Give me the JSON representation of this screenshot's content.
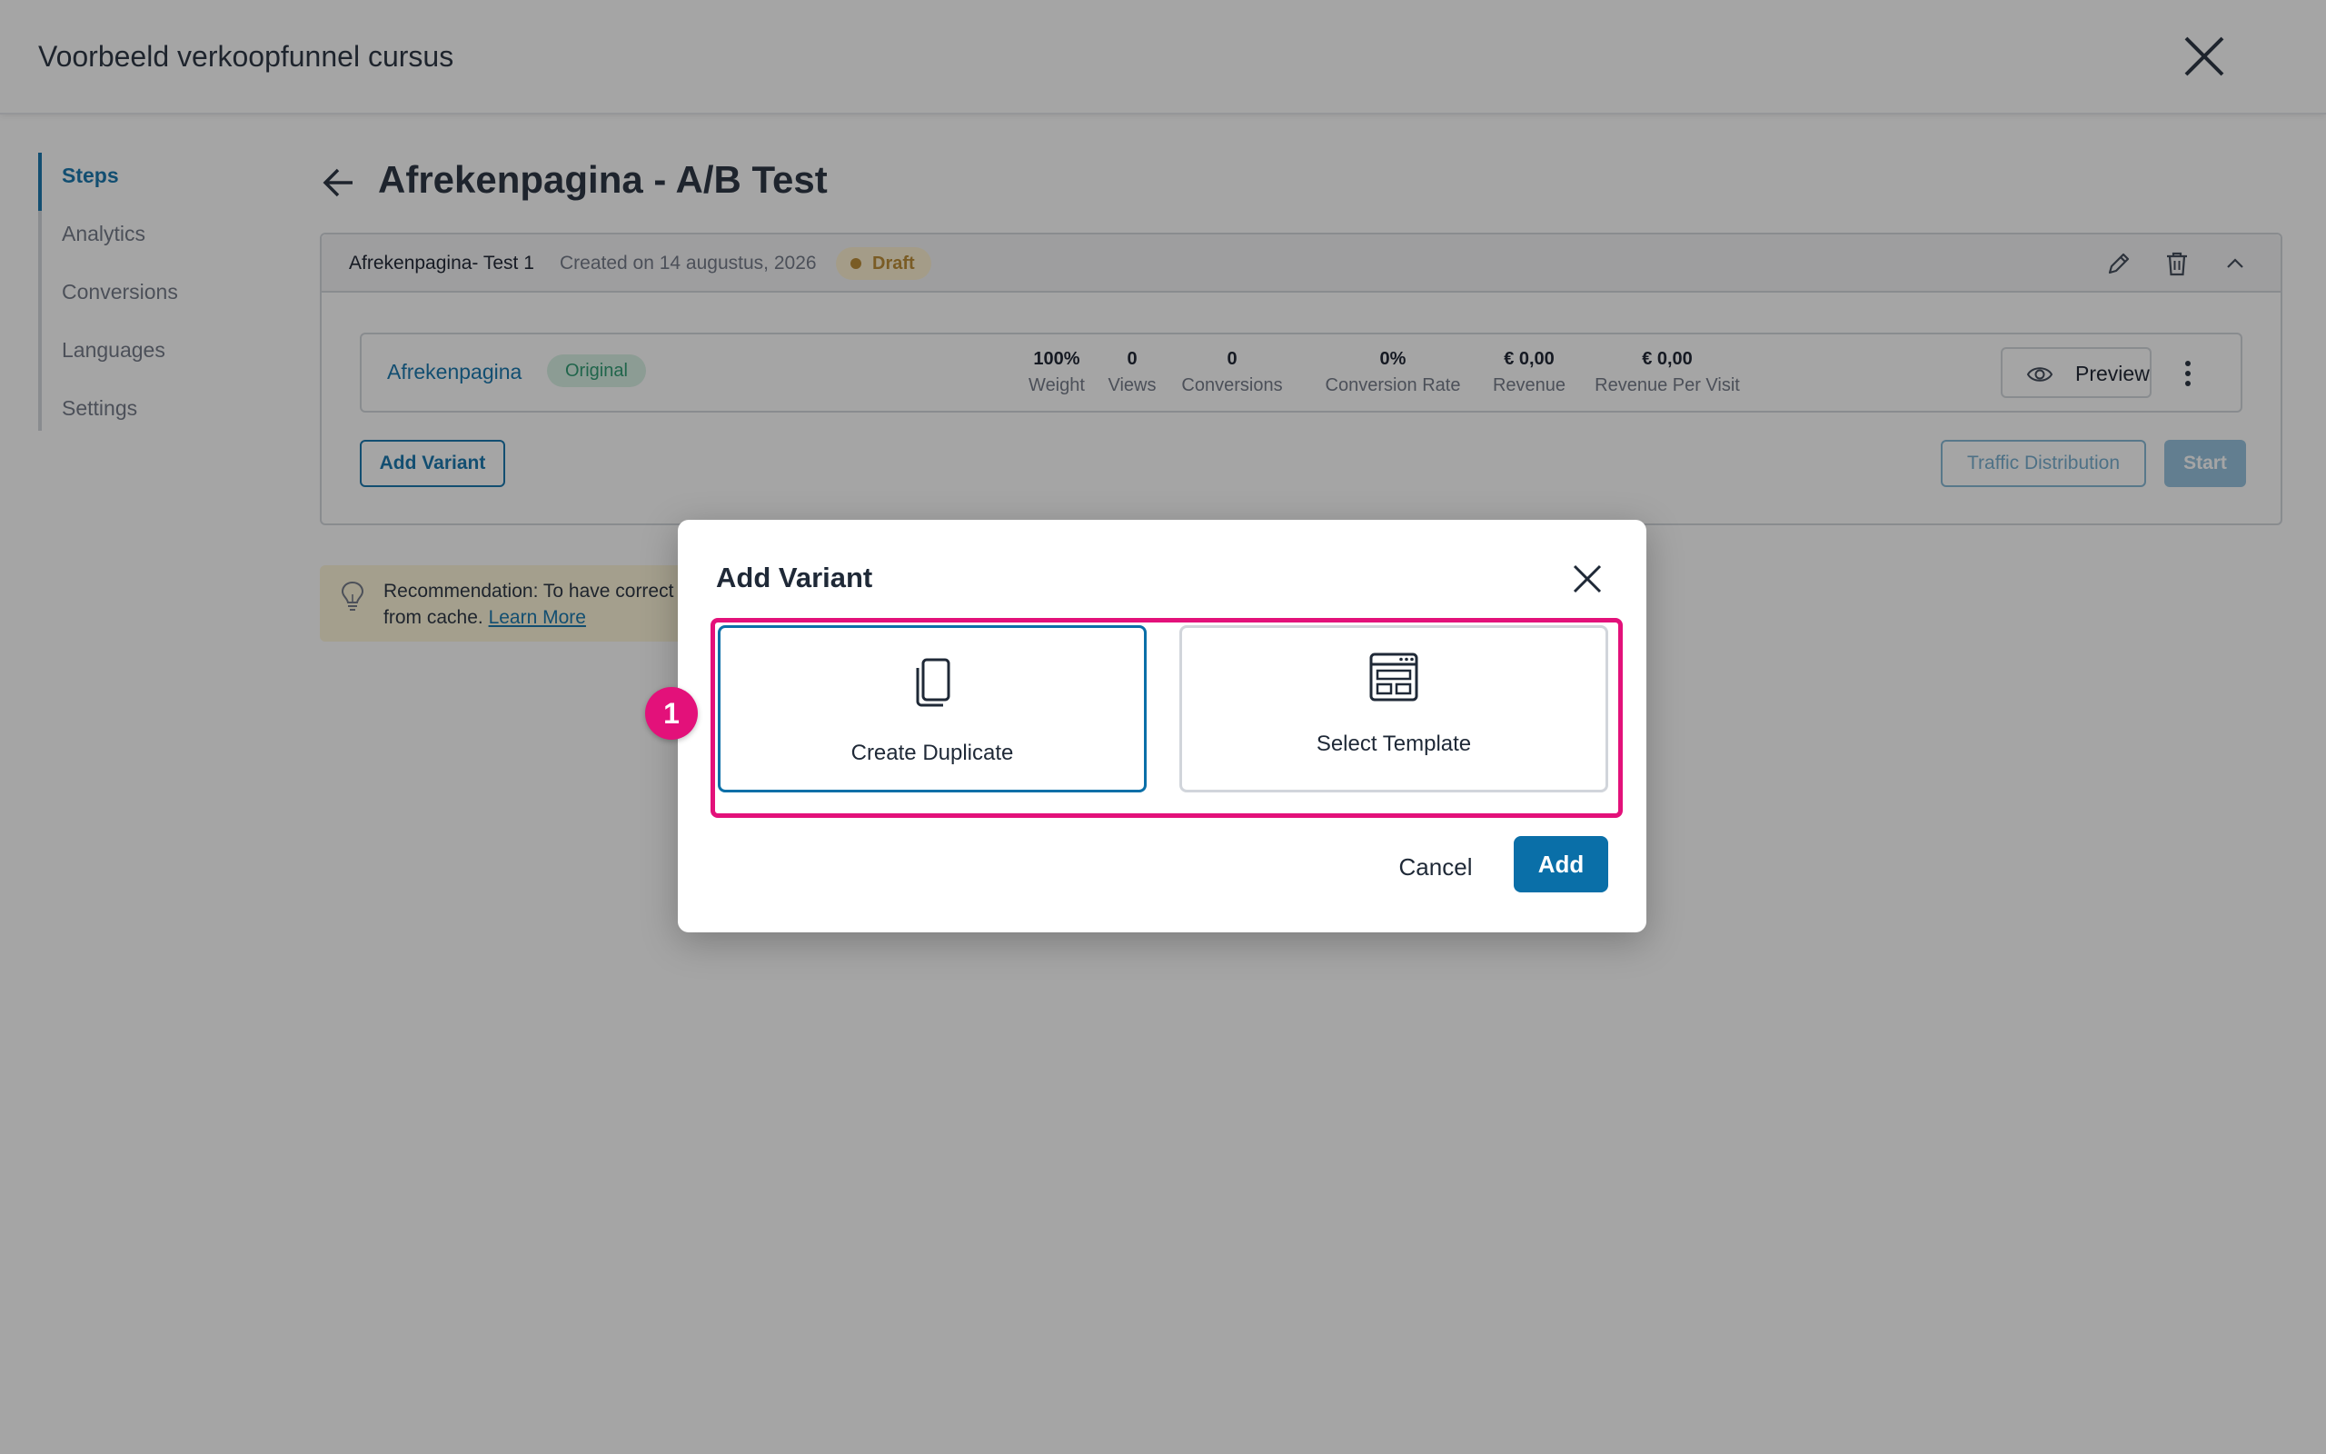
{
  "app": {
    "title": "Voorbeeld verkoopfunnel cursus"
  },
  "sidebar": {
    "items": [
      {
        "label": "Steps",
        "active": true
      },
      {
        "label": "Analytics"
      },
      {
        "label": "Conversions"
      },
      {
        "label": "Languages"
      },
      {
        "label": "Settings"
      }
    ]
  },
  "page": {
    "title": "Afrekenpagina - A/B Test"
  },
  "test": {
    "name": "Afrekenpagina- Test 1",
    "created": "Created on 14 augustus, 2026",
    "status": "Draft",
    "variant": {
      "name": "Afrekenpagina",
      "badge": "Original",
      "stats": [
        {
          "value": "100%",
          "label": "Weight"
        },
        {
          "value": "0",
          "label": "Views"
        },
        {
          "value": "0",
          "label": "Conversions"
        },
        {
          "value": "0%",
          "label": "Conversion Rate"
        },
        {
          "value": "€ 0,00",
          "label": "Revenue"
        },
        {
          "value": "€ 0,00",
          "label": "Revenue Per Visit"
        }
      ],
      "preview_label": "Preview"
    },
    "add_variant_label": "Add Variant",
    "traffic_label": "Traffic Distribution",
    "start_label": "Start"
  },
  "recommendation": {
    "line1": "Recommendation: To have correct",
    "line2_prefix": "from cache.",
    "link": "Learn More"
  },
  "modal": {
    "title": "Add Variant",
    "options": [
      {
        "label": "Create Duplicate",
        "selected": true
      },
      {
        "label": "Select Template",
        "selected": false
      }
    ],
    "cancel_label": "Cancel",
    "add_label": "Add"
  },
  "annotation": {
    "marker": "1"
  },
  "colors": {
    "accent": "#0a6fa8",
    "highlight": "#e3117a",
    "draft": "#b7852b",
    "original": "#22946a"
  }
}
